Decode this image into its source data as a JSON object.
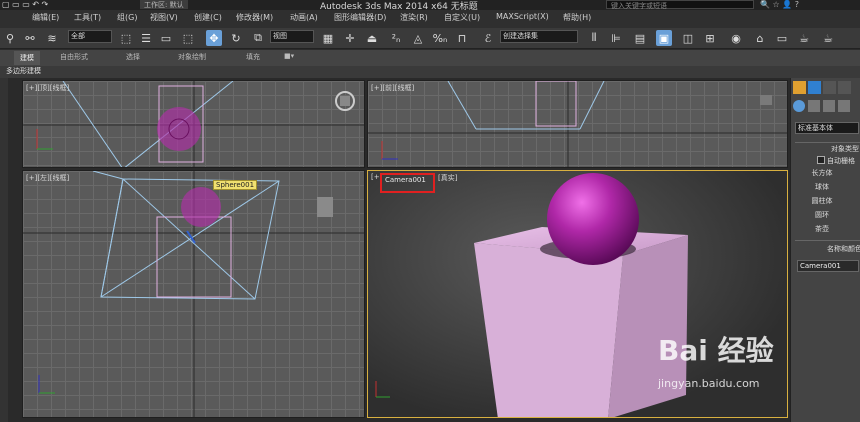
{
  "titlebar": {
    "workspace": "工作区: 默认",
    "title": "Autodesk 3ds Max  2014 x64     无标题",
    "search_placeholder": "键入关键字或短语"
  },
  "menu": [
    "编辑(E)",
    "工具(T)",
    "组(G)",
    "视图(V)",
    "创建(C)",
    "修改器(M)",
    "动画(A)",
    "图形编辑器(D)",
    "渲染(R)",
    "自定义(U)",
    "MAXScript(X)",
    "帮助(H)"
  ],
  "toolbar": {
    "selection_filter": "全部",
    "ref_coord": "视图",
    "named_selection": "创建选择集"
  },
  "ribbon": {
    "tabs": [
      "建模",
      "自由形式",
      "选择",
      "对象绘制",
      "填充"
    ],
    "active": "建模",
    "sub": "多边形建模"
  },
  "viewports": {
    "top_left_label": "[+][顶][线框]",
    "top_right_label": "[+][前][线框]",
    "bottom_left_label": "[+][左][线框]",
    "camera_label_prefix": "[+]",
    "camera_name": "Camera001",
    "camera_mode": "[真实]",
    "sphere_tooltip": "Sphere001"
  },
  "panel": {
    "dropdown": "标准基本体",
    "rollout_object_type": "对象类型",
    "autogrid": "自动栅格",
    "buttons": [
      "长方体",
      "球体",
      "圆柱体",
      "圆环",
      "茶壶"
    ],
    "rollout_name": "名称和颜色",
    "name_value": "Camera001"
  },
  "watermark": {
    "brand": "Bai  经验",
    "url": "jingyan.baidu.com"
  },
  "colors": {
    "sphere": "#b030a8",
    "box": "#d8a8d8",
    "camera_highlight": "#e02020",
    "accent": "#6aa0d8"
  }
}
